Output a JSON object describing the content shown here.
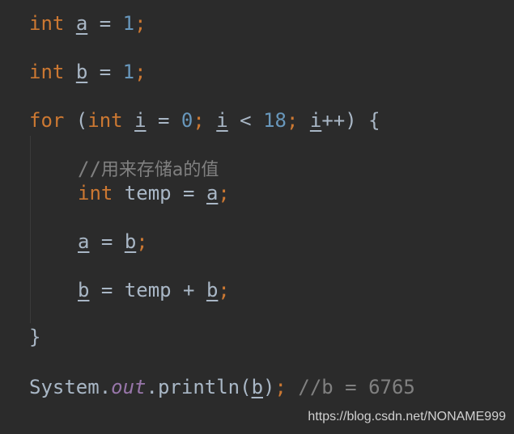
{
  "code": {
    "line1": {
      "kw": "int",
      "var": "a",
      "op": " = ",
      "num": "1",
      "semi": ";"
    },
    "line2": {
      "kw": "int",
      "var": "b",
      "op": " = ",
      "num": "1",
      "semi": ";"
    },
    "line3": {
      "kw_for": "for",
      "paren_open": " (",
      "kw_int": "int",
      "var_i1": "i",
      "op1": " = ",
      "num0": "0",
      "semi1": ";",
      "var_i2": "i",
      "op2": " < ",
      "num18": "18",
      "semi2": ";",
      "var_i3": "i",
      "op3": "++) {"
    },
    "comment1": {
      "slashes": "//",
      "text": "用来存储a的值"
    },
    "line4": {
      "kw": "int",
      "mid": " temp = ",
      "var": "a",
      "semi": ";"
    },
    "line5": {
      "var1": "a",
      "op": " = ",
      "var2": "b",
      "semi": ";"
    },
    "line6": {
      "var1": "b",
      "op": " = temp + ",
      "var2": "b",
      "semi": ";"
    },
    "close_brace": "}",
    "line7": {
      "cls": "System.",
      "field": "out",
      "call": ".println(",
      "var": "b",
      "close": ")",
      "semi": ";",
      "comment": " //b = 6765"
    }
  },
  "watermark": "https://blog.csdn.net/NONAME999"
}
